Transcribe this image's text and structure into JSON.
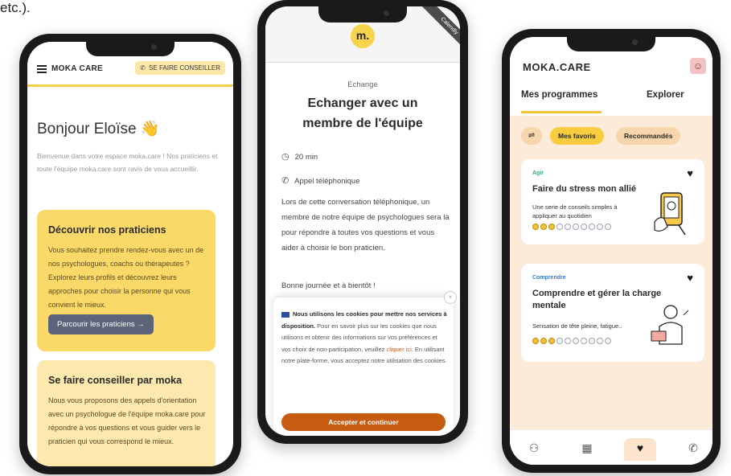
{
  "caption_fragment": "etc.).",
  "phone1": {
    "brand": "MOKA CARE",
    "advise_button": "SE FAIRE CONSEILLER",
    "greeting": "Bonjour Eloïse",
    "greeting_emoji": "👋",
    "intro": "Bienvenue dans votre espace moka.care ! Nos praticiens et toute l'équipe moka.care sont ravis de vous accueillir.",
    "card1": {
      "title": "Découvrir nos praticiens",
      "body": "Vous souhaitez prendre rendez-vous avec un de nos psychologues, coachs ou thérapeutes ? Explorez leurs profils et découvrez leurs approches pour choisir la personne qui vous convient le mieux.",
      "button": "Parcourir les praticiens"
    },
    "card2": {
      "title": "Se faire conseiller par moka",
      "body": "Nous vous proposons des appels d'orientation avec un psychologue de l'équipe moka.care pour répondre à vos questions et vous guider vers le praticien qui vous correspond le mieux."
    }
  },
  "phone2": {
    "logo": "m.",
    "ribbon": "Calendly",
    "eyebrow": "Echange",
    "title": "Echanger avec un membre de l'équipe",
    "duration": "20 min",
    "call_type": "Appel téléphonique",
    "description": "Lors de cette conversation téléphonique, un membre de notre équipe de psychologues sera là pour répondre à toutes vos questions et vous aider à choisir le bon praticien.",
    "farewell": "Bonne journée et à bientôt !",
    "cookie": {
      "bold": "Nous utilisons les cookies pour mettre nos services à disposition.",
      "text1": " Pour en savoir plus sur les cookies que nous utilisons et obtenir des informations sur vos préférences et vos choix de non-participation, veuillez ",
      "link": "cliquer ici",
      "text2": ". En utilisant notre plate-forme, vous acceptez notre utilisation des cookies.",
      "accept": "Accepter et continuer"
    }
  },
  "phone3": {
    "brand": "MOKA.CARE",
    "tabs": [
      "Mes programmes",
      "Explorer"
    ],
    "chips": [
      "Mes favoris",
      "Recommandés"
    ],
    "programs": [
      {
        "tag": "Agir",
        "title": "Faire du stress mon allié",
        "desc": "Une serie de conseils simples à appliquer au quotidien",
        "progress": 3,
        "total": 10
      },
      {
        "tag": "Comprendre",
        "title": "Comprendre et gérer la charge mentale",
        "desc": "Sensation de tête pleine, fatigue..",
        "progress": 3,
        "total": 10
      }
    ],
    "nav": [
      "people-icon",
      "calendar-icon",
      "heart-icon",
      "phone-icon"
    ],
    "accent": "#f5c33a"
  }
}
